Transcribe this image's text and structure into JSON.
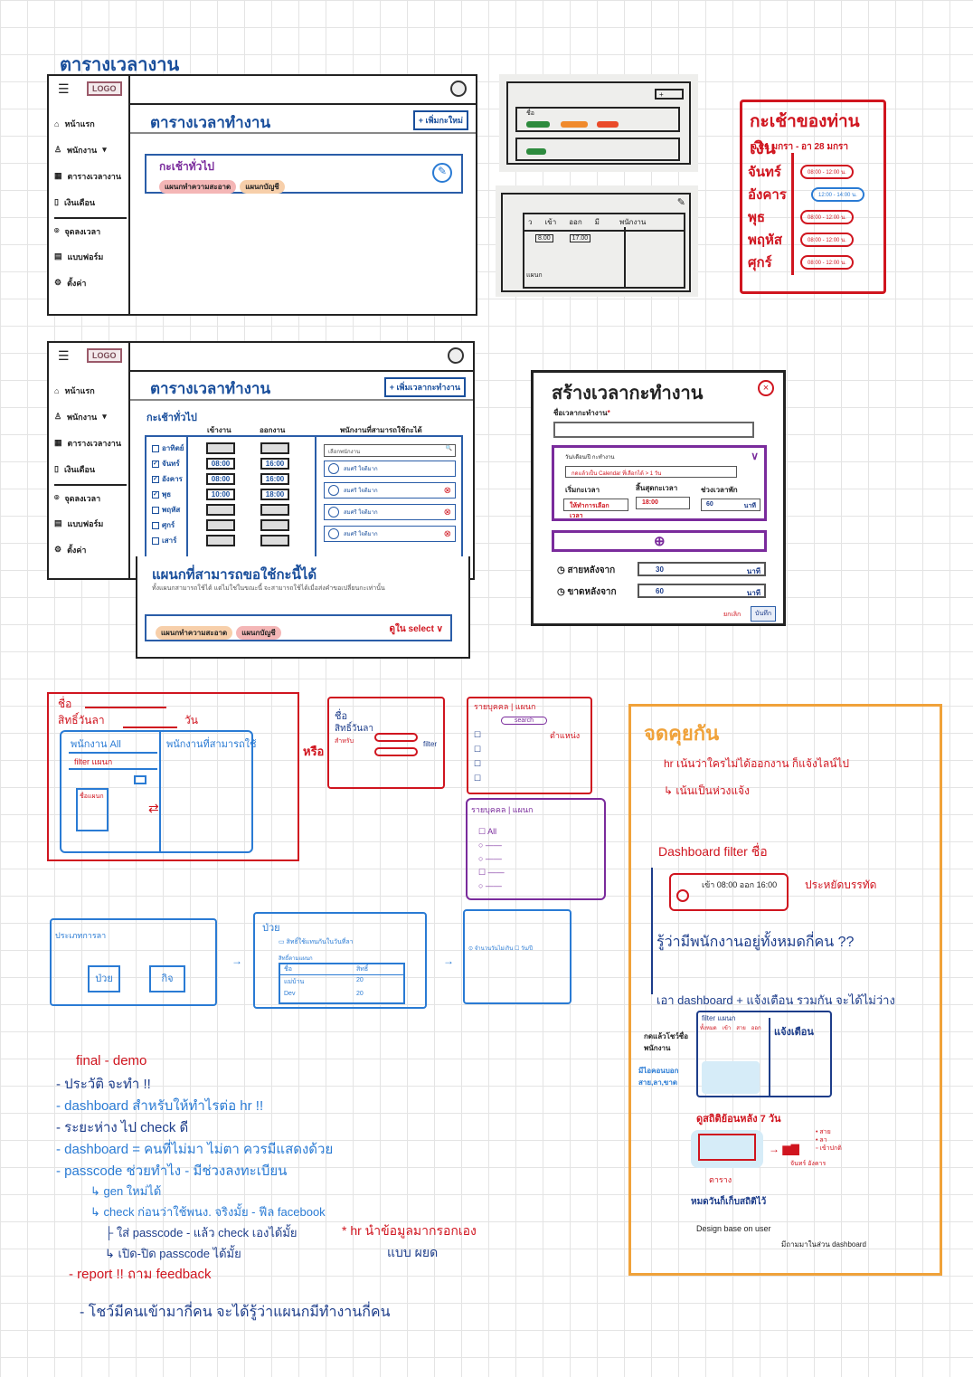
{
  "page_title": "ตารางเวลางาน",
  "nav_items": [
    "หน้าแรก",
    "พนักงาน",
    "ตารางเวลางาน",
    "เงินเดือน",
    "จุดลงเวลา",
    "แบบฟอร์ม",
    "ตั้งค่า"
  ],
  "nav_icons": [
    "home-icon",
    "user-icon",
    "calendar-icon",
    "money-icon",
    "location-pin-icon",
    "form-icon",
    "gear-icon"
  ],
  "logo": "LOGO",
  "wireframe1": {
    "title": "ตารางเวลาทำงาน",
    "add_button": "+ เพิ่มกะใหม่",
    "shift_name": "กะเช้าทั่วไป",
    "tags": [
      "แผนกทำความสะอาด",
      "แผนกบัญชี"
    ]
  },
  "wireframe2": {
    "title": "ตารางเวลาทำงาน",
    "add_button": "+ เพิ่มเวลากะทำงาน",
    "shift_name": "กะเช้าทั่วไป",
    "col_in": "เข้างาน",
    "col_out": "ออกงาน",
    "col_staff": "พนักงานที่สามารถใช้กะได้",
    "days": [
      {
        "name": "อาทิตย์",
        "checked": false,
        "in": "",
        "out": ""
      },
      {
        "name": "จันทร์",
        "checked": true,
        "in": "08:00",
        "out": "16:00"
      },
      {
        "name": "อังคาร",
        "checked": true,
        "in": "08:00",
        "out": "16:00"
      },
      {
        "name": "พุธ",
        "checked": true,
        "in": "10:00",
        "out": "18:00"
      },
      {
        "name": "พฤหัส",
        "checked": false,
        "in": "",
        "out": ""
      },
      {
        "name": "ศุกร์",
        "checked": false,
        "in": "",
        "out": ""
      },
      {
        "name": "เสาร์",
        "checked": false,
        "in": "",
        "out": ""
      }
    ],
    "search_placeholder": "เลือกพนักงาน",
    "employees": [
      "สมศรี ใจดีมาก",
      "สมศรี ใจดีมาก",
      "สมศรี ใจดีมาก",
      "สมศรี ใจดีมาก"
    ],
    "dept_title": "แผนกที่สามารถขอใช้กะนี้ได้",
    "dept_desc": "ทั้งแผนกสามารถใช้ได้ แต่ไม่ใช่ในขณะนี้ จะสามารถใช้ได้เมื่อส่งคำขอเปลี่ยนกะเท่านั้น",
    "tags": [
      "แผนกทำความสะอาด",
      "แผนกบัญชี"
    ],
    "select_note": "ดูใน select ∨"
  },
  "schedule_note": {
    "title": "กะเช้าของท่านเงิน",
    "range": "จ 21 มกรา - อา 28 มกรา",
    "rows": [
      {
        "day": "จันทร์",
        "time": "08:00 - 12:00 น."
      },
      {
        "day": "อังคาร",
        "time": "12:00 - 14:00 น."
      },
      {
        "day": "พุธ",
        "time": "08:00 - 12:00 น."
      },
      {
        "day": "พฤหัส",
        "time": "08:00 - 12:00 น."
      },
      {
        "day": "ศุกร์",
        "time": "08:00 - 12:00 น."
      }
    ]
  },
  "photo_sketch": {
    "name_label": "ชื่อ",
    "header": [
      "ว",
      "เข้า",
      "ออก",
      "มี",
      "พนักงาน"
    ],
    "times": [
      "8.00",
      "17.00"
    ],
    "dept": "แผนก"
  },
  "modal": {
    "title": "สร้างเวลากะทำงาน",
    "name_label": "ชื่อเวลากะทำงาน",
    "required": "*",
    "date_label": "วัน/เดือน/ปี กะทำงาน",
    "date_note": "กดแล้วเป็น Calendar ที่เลือกได้ > 1 วัน",
    "start_label": "เริ่มกะเวลา",
    "end_label": "สิ้นสุดกะเวลา",
    "break_label": "ช่วงเวลาพัก",
    "start_value": "ให้ทำการเลือกเวลา",
    "end_value": "18:00",
    "break_value": "60",
    "unit": "นาที",
    "late_label": "สายหลังจาก",
    "late_value": "30",
    "absent_label": "ขาดหลังจาก",
    "absent_value": "60",
    "cancel": "ยกเลิก",
    "save": "บันทึก"
  },
  "sketch_leave": {
    "name": "ชื่อ",
    "rights": "สิทธิ์วันลา",
    "days": "วัน",
    "left_col": "พนักงาน All",
    "filter": "filter แผนก",
    "right_col": "พนักงานที่สามารถใช้",
    "dept_box": "ชื่อแผนก",
    "or": "หรือ",
    "s2_name": "ชื่อ",
    "s2_rights": "สิทธิ์วันลา",
    "s2_for": "สำหรับ",
    "s2_filter": "filter",
    "s3_tabs": [
      "รายบุคคล",
      "แผนก"
    ],
    "s3_search": "search",
    "s3_pos": "ตำแหน่ง",
    "s4_tabs": [
      "รายบุคคล",
      "แผนก"
    ],
    "s4_all": "All"
  },
  "sketch_types": {
    "title": "ประเภทการลา",
    "btn1": "ป่วย",
    "btn2": "กิจ",
    "p2_title": "ป่วย",
    "p2_toggle": "สิทธิ์ใช้แทนกันในวันที่ลา",
    "p2_sub": "สิทธิ์ตามแผนก",
    "p2_head": [
      "ชื่อ",
      "สิทธิ์"
    ],
    "p2_rows": [
      [
        "แม่บ้าน",
        "20"
      ],
      [
        "Dev",
        "20"
      ]
    ],
    "p3_text": "จำนวนวันไม่เกิน",
    "p3_unit": "วัน/ปี"
  },
  "notes": {
    "title": "จดคุยกัน",
    "l1": "hr เน้นว่าใครไม่ได้ออกงาน ก็แจ้งไลน์ไป",
    "l2": "↳ เน้นเป็นห่วงแจ้ง",
    "dash": "Dashboard  filter ชื่อ",
    "card": "เข้า 08:00  ออก 16:00",
    "card_note": "ประหยัดบรรทัด",
    "q": "รู้ว่ามีพนักงานอยู่ทั้งหมดกี่คน ??",
    "b3": "เอา dashboard + แจ้งเตือน รวมกัน จะได้ไม่ว่าง",
    "filter": "filter แผนก",
    "cols": [
      "ทั้งหมด",
      "เข้า",
      "สาย",
      "ออก"
    ],
    "alerts": "แจ้งเตือน",
    "click": "กดแล้วโชว์ชื่อพนักงาน",
    "icon_note": "มีไอคอนบอก สาย,ลา,ขาด",
    "stats": "ดูสถิติย้อนหลัง 7 วัน",
    "table": "ตาราง",
    "legend": [
      "สาย",
      "ลา",
      "เข้าปกติ"
    ],
    "days": "จันทร์ อังคาร",
    "keep": "หมดวันก็เก็บสถิติไว้",
    "design": "Design base on user",
    "design2": "มีถามมาในส่วน dashboard"
  },
  "todo": {
    "title": "final - demo",
    "items": [
      "- ประวัติ จะทำ !!",
      "- dashboard สำหรับให้ทำไรต่อ hr !!",
      "- ระยะห่าง ไป check ดี",
      "- dashboard = คนที่ไม่มา ไม่ตา ควรมีแสดงด้วย",
      "- passcode ช่วยทำไง - มีช่วงลงทะเบียน"
    ],
    "sub": [
      "↳ gen ใหม่ได้",
      "↳ check ก่อนว่าใช้พนง. จริงมั้ย - ฟีล facebook",
      "├ ใส่ passcode - แล้ว check เองได้มั้ย",
      "↳ เปิด-ปิด passcode ได้มั้ย"
    ],
    "hr_note": "* hr นำข้อมูลมากรอกเอง",
    "hr_note2": "แบบ ผยด",
    "report": "- report !!  ถาม feedback",
    "last": "- โชว์มีคนเข้ามากี่คน จะได้รู้ว่าแผนกมีทำงานกี่คน"
  }
}
